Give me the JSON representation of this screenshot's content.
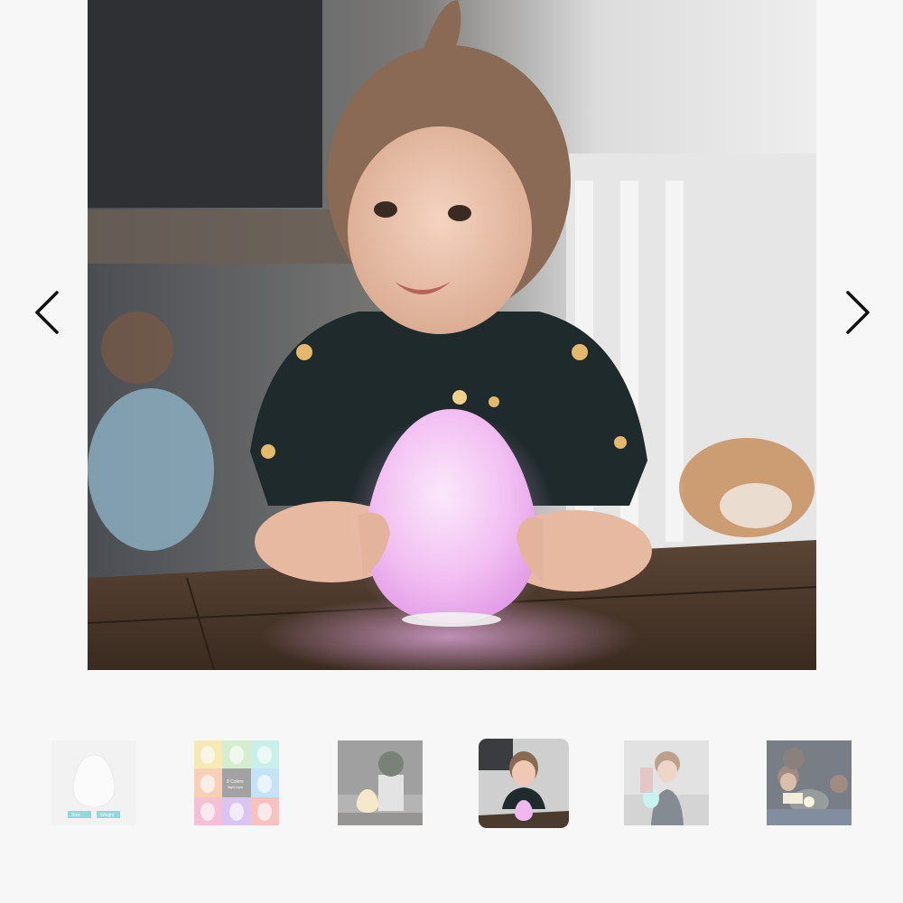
{
  "gallery": {
    "main_image": {
      "alt": "toddler holding glowing pink egg night light",
      "subject_icon": "egg-night-light",
      "glow_color": "#f3b6f2"
    },
    "prev_arrow_icon": "chevron-left-icon",
    "next_arrow_icon": "chevron-right-icon",
    "active_index": 3,
    "thumbnails": [
      {
        "alt": "white egg lamp",
        "tag1": "Size",
        "tag2": "Weight"
      },
      {
        "alt": "color grid",
        "headline": "8 Colors",
        "sub": "Night Light",
        "colors": [
          "#f6e28a",
          "#bfe9b8",
          "#a9ece1",
          "#f9b98d",
          "#ffffff",
          "#a6d8f6",
          "#f59dc1",
          "#c9a6f3",
          "#f7a19f"
        ]
      },
      {
        "alt": "lamp with plant"
      },
      {
        "alt": "toddler with lamp"
      },
      {
        "alt": "child with lamp"
      },
      {
        "alt": "family reading in dark"
      }
    ]
  }
}
